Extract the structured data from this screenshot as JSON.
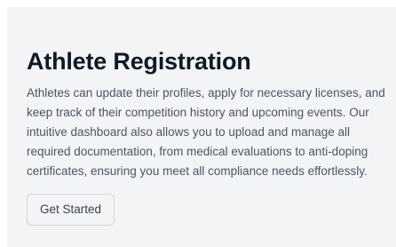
{
  "card": {
    "title": "Athlete Registration",
    "description": "Athletes can update their profiles, apply for necessary licenses, and keep track of their competition history and upcoming events. Our intuitive dashboard also allows you to upload and manage all required documentation, from medical evaluations to anti-doping certificates, ensuring you meet all compliance needs effortlessly.",
    "button_label": "Get Started"
  },
  "colors": {
    "card_background": "#f3f4f6",
    "title": "#111827",
    "text": "#4b5563",
    "button_border": "#d1d5db"
  }
}
